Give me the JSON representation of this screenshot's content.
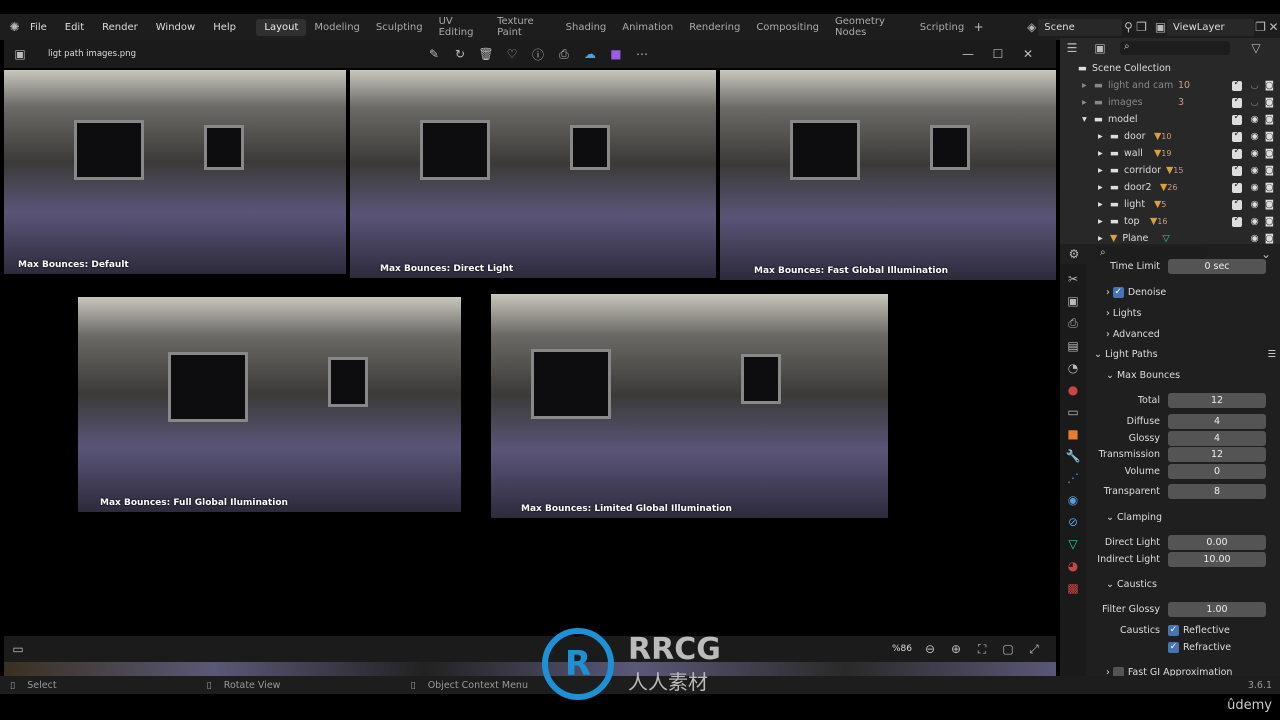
{
  "menu": {
    "items": [
      "File",
      "Edit",
      "Render",
      "Window",
      "Help"
    ]
  },
  "workspaces": [
    "Layout",
    "Modeling",
    "Sculpting",
    "UV Editing",
    "Texture Paint",
    "Shading",
    "Animation",
    "Rendering",
    "Compositing",
    "Geometry Nodes",
    "Scripting"
  ],
  "scene": "Scene",
  "view_layer": "ViewLayer",
  "viewer": {
    "filename": "ligt path images.png",
    "zoom": "%86",
    "images": [
      {
        "caption": "Max Bounces: Default"
      },
      {
        "caption": "Max Bounces: Direct Light"
      },
      {
        "caption": "Max Bounces: Fast Global Illumination"
      },
      {
        "caption": "Max Bounces: Full Global Ilumination"
      },
      {
        "caption": "Max Bounces: Limited Global Illumination"
      }
    ]
  },
  "outliner": {
    "root": "Scene Collection",
    "items": [
      {
        "name": "light and cam",
        "count": "10",
        "dim": true
      },
      {
        "name": "images",
        "count": "3",
        "dim": true
      },
      {
        "name": "model",
        "count": ""
      },
      {
        "name": "door",
        "count": "10"
      },
      {
        "name": "wall",
        "count": "19"
      },
      {
        "name": "corridor",
        "count": "15"
      },
      {
        "name": "door2",
        "count": "26"
      },
      {
        "name": "light",
        "count": "5"
      },
      {
        "name": "top",
        "count": "16"
      },
      {
        "name": "Plane",
        "count": ""
      }
    ]
  },
  "properties": {
    "time_limit": {
      "label": "Time Limit",
      "value": "0 sec"
    },
    "denoise": "Denoise",
    "lights": "Lights",
    "advanced": "Advanced",
    "light_paths": "Light Paths",
    "max_bounces": "Max Bounces",
    "bounces": [
      {
        "label": "Total",
        "value": "12"
      },
      {
        "label": "Diffuse",
        "value": "4"
      },
      {
        "label": "Glossy",
        "value": "4"
      },
      {
        "label": "Transmission",
        "value": "12"
      },
      {
        "label": "Volume",
        "value": "0"
      },
      {
        "label": "Transparent",
        "value": "8"
      }
    ],
    "clamping": "Clamping",
    "clamp": [
      {
        "label": "Direct Light",
        "value": "0.00"
      },
      {
        "label": "Indirect Light",
        "value": "10.00"
      }
    ],
    "caustics": "Caustics",
    "filter_glossy": {
      "label": "Filter Glossy",
      "value": "1.00"
    },
    "caustics_label": "Caustics",
    "reflective": "Reflective",
    "refractive": "Refractive",
    "fast_gi": "Fast GI Approximation"
  },
  "status": {
    "select": "Select",
    "rotate": "Rotate View",
    "context": "Object Context Menu",
    "version": "3.6.1"
  },
  "watermark": {
    "brand": "RRCG",
    "sub": "人人素材",
    "udemy": "ûdemy"
  }
}
